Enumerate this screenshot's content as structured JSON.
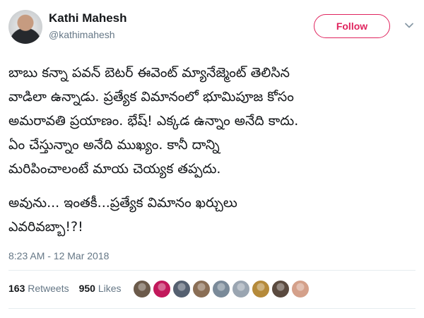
{
  "author": {
    "display_name": "Kathi Mahesh",
    "username": "@kathimahesh"
  },
  "actions": {
    "follow_label": "Follow",
    "menu_icon": "chevron-down-icon"
  },
  "tweet": {
    "lines": [
      "బాబు కన్నా పవన్ బెటర్ ఈవెంట్ మ్యానేజ్మెంట్ తెలిసిన",
      "వాడిలా ఉన్నాడు. ప్రత్యేక విమానంలో భూమిపూజ కోసం",
      "అమరావతి ప్రయాణం. భేష్! ఎక్కడ ఉన్నాం అనేది కాదు.",
      "ఏం చేస్తున్నాం అనేది ముఖ్యం. కానీ దాన్ని",
      "మరిపించాలంటే మాయ చెయ్యక తప్పదు."
    ],
    "lines2": [
      "అవును... ఇంతకీ...ప్రత్యేక విమానం ఖర్చులు",
      "ఎవరివబ్బా!?!"
    ],
    "timestamp": "8:23 AM - 12 Mar 2018"
  },
  "stats": {
    "retweets_count": "163",
    "retweets_label": "Retweets",
    "likes_count": "950",
    "likes_label": "Likes"
  },
  "likers": [
    {
      "color": "#6b5a4a"
    },
    {
      "color": "#c2185b"
    },
    {
      "color": "#556070"
    },
    {
      "color": "#8a6e55"
    },
    {
      "color": "#7a8a99"
    },
    {
      "color": "#9aa5b1"
    },
    {
      "color": "#b58a3a"
    },
    {
      "color": "#5a4a3f"
    },
    {
      "color": "#d4a08a"
    }
  ],
  "colors": {
    "accent": "#e0245e",
    "secondary_text": "#657786"
  }
}
